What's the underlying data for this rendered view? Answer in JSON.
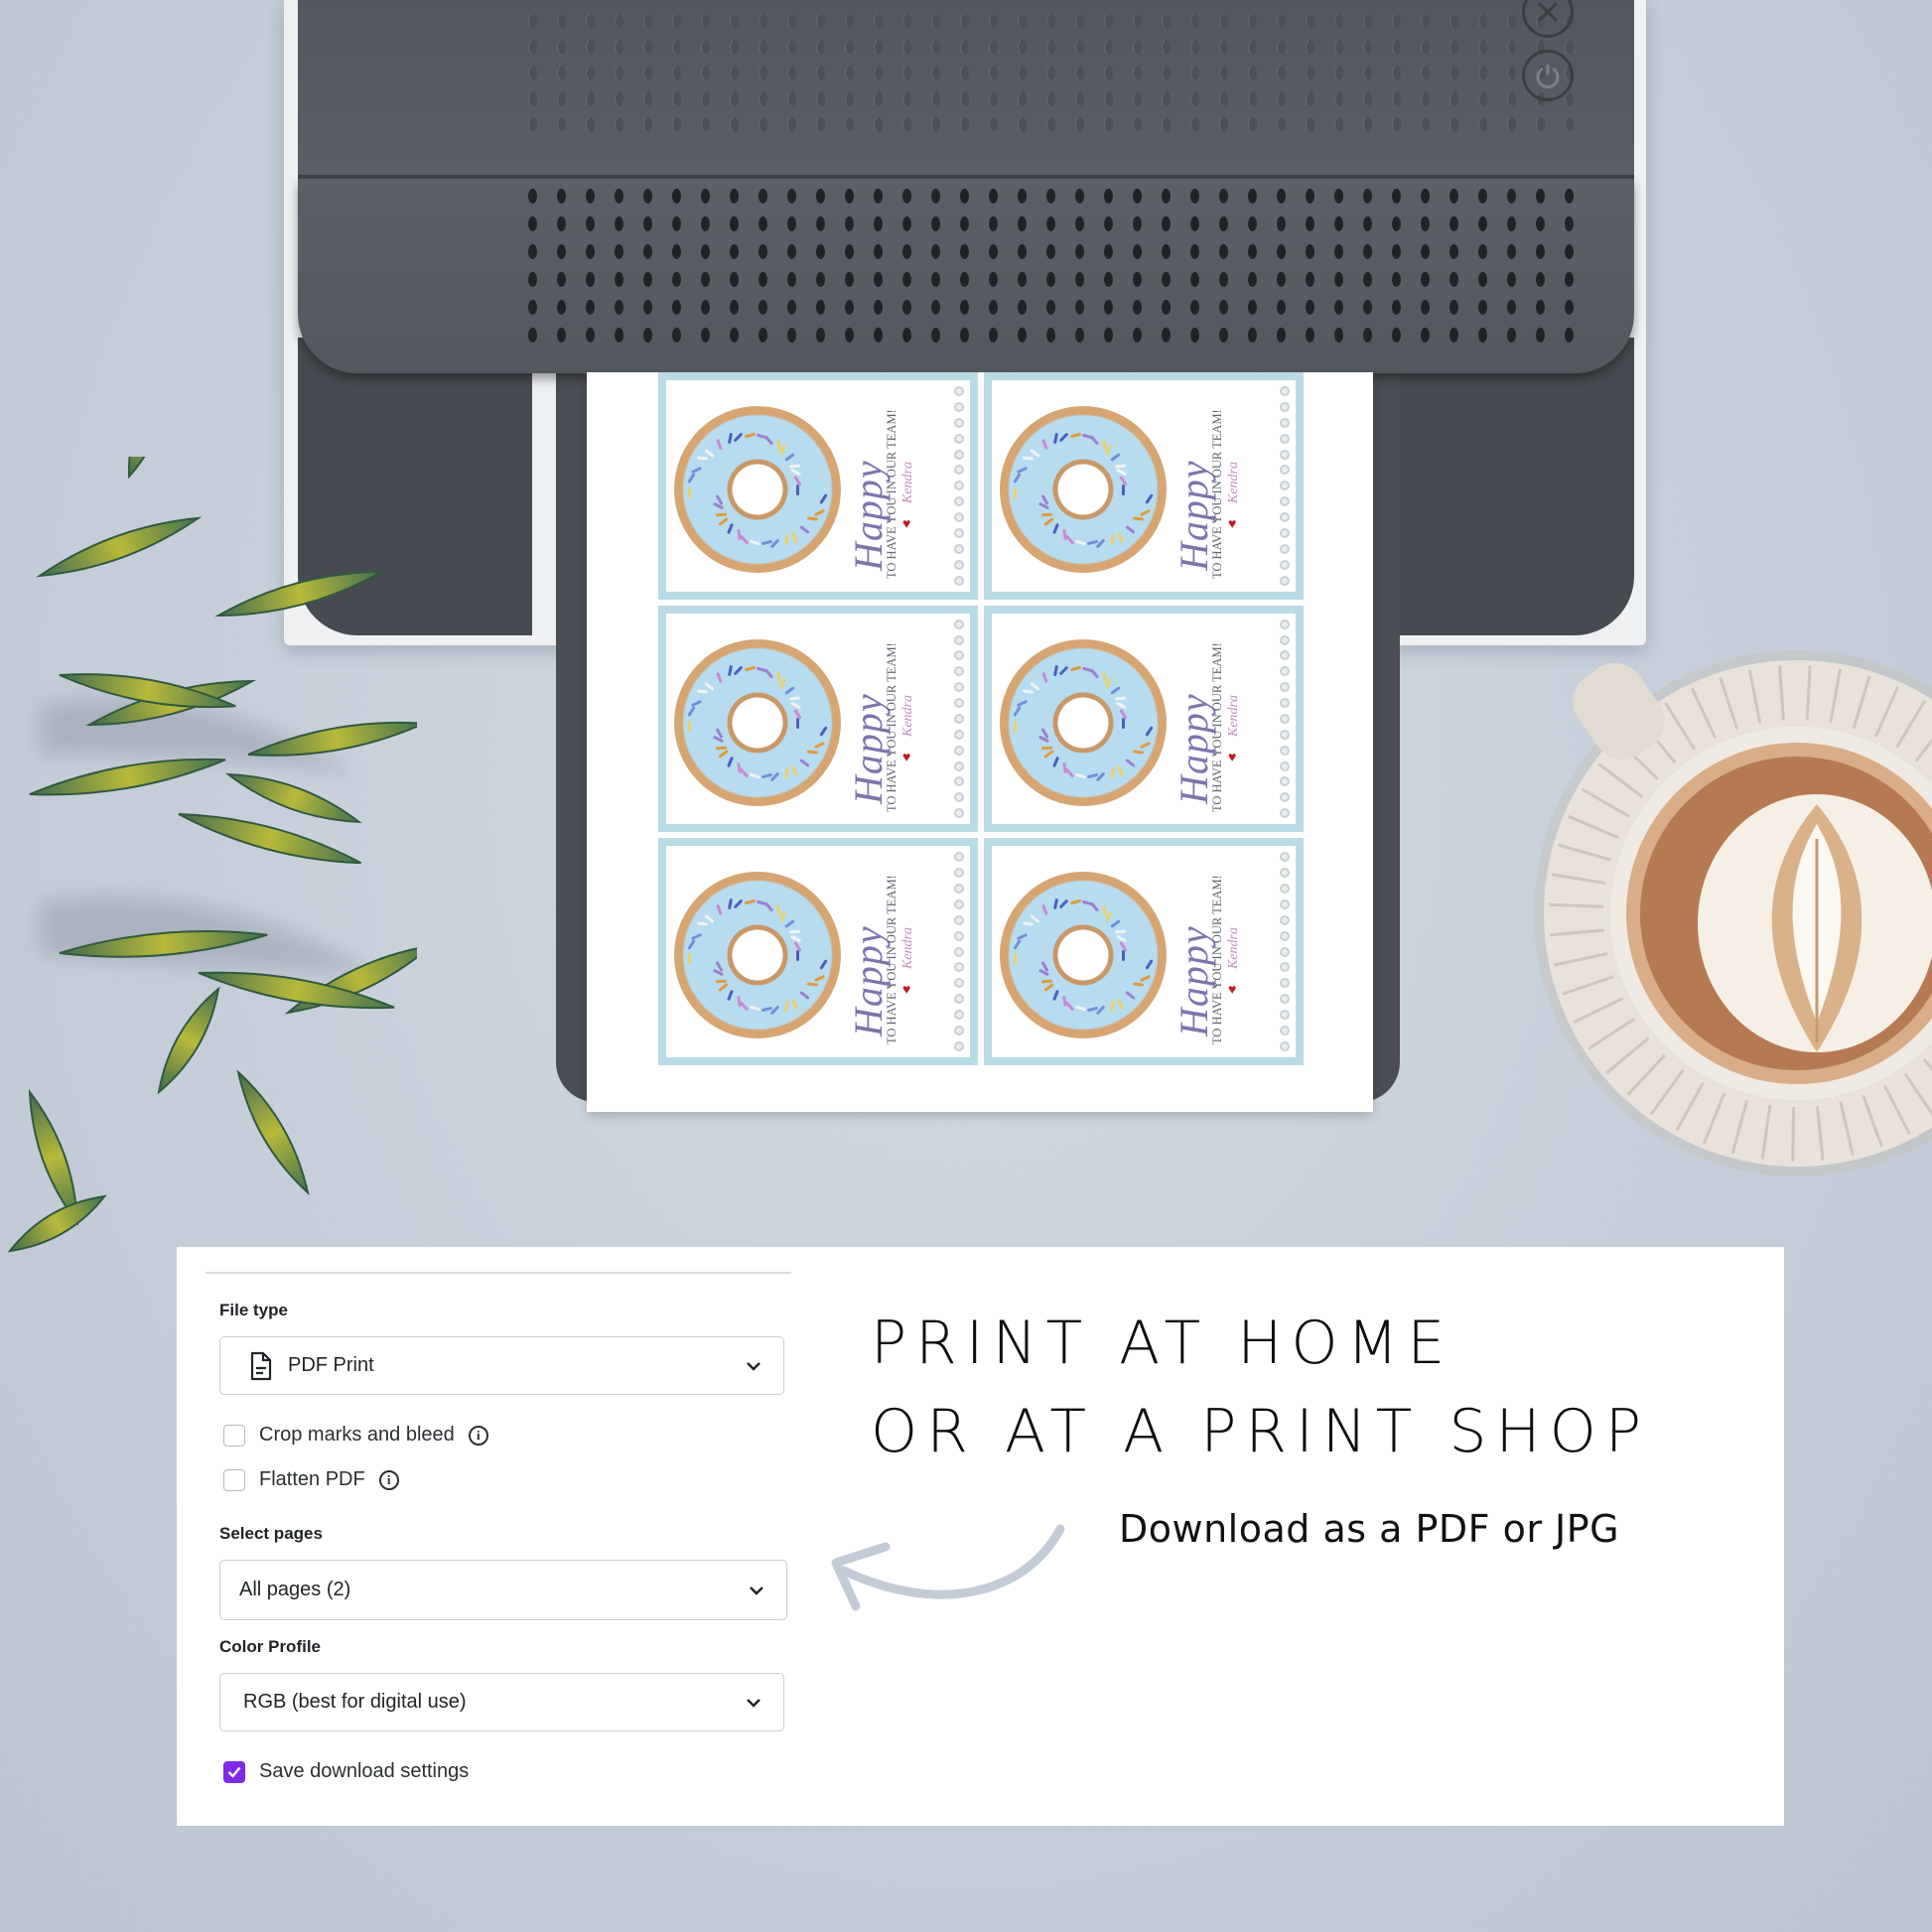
{
  "printer": {
    "buttons": [
      {
        "name": "cancel",
        "icon": "close-circle-icon"
      },
      {
        "name": "power",
        "icon": "power-icon"
      }
    ]
  },
  "printout": {
    "cards": [
      {
        "title": "Happy",
        "subtitle": "TO HAVE YOU IN OUR TEAM!",
        "signature": "Kendra"
      },
      {
        "title": "Happy",
        "subtitle": "TO HAVE YOU IN OUR TEAM!",
        "signature": "Kendra"
      },
      {
        "title": "Happy",
        "subtitle": "TO HAVE YOU IN OUR TEAM!",
        "signature": "Kendra"
      },
      {
        "title": "Happy",
        "subtitle": "TO HAVE YOU IN OUR TEAM!",
        "signature": "Kendra"
      },
      {
        "title": "Happy",
        "subtitle": "TO HAVE YOU IN OUR TEAM!",
        "signature": "Kendra"
      },
      {
        "title": "Happy",
        "subtitle": "TO HAVE YOU IN OUR TEAM!",
        "signature": "Kendra"
      }
    ],
    "colors": {
      "card_border": "#b9dbe6",
      "title": "#7c74ad",
      "signature": "#c48ac0",
      "heart": "#c3161f"
    }
  },
  "download_panel": {
    "file_type": {
      "label": "File type",
      "value": "PDF Print",
      "icon": "document-icon"
    },
    "options": [
      {
        "label": "Crop marks and bleed",
        "checked": false,
        "info": "i"
      },
      {
        "label": "Flatten PDF",
        "checked": false,
        "info": "i"
      }
    ],
    "select_pages": {
      "label": "Select pages",
      "value": "All pages (2)"
    },
    "color_profile": {
      "label": "Color Profile",
      "value": "RGB (best for digital use)"
    },
    "save_settings": {
      "label": "Save download settings",
      "checked": true
    },
    "accent_color": "#7d2ae8"
  },
  "promo": {
    "headline_line1": "PRINT AT HOME",
    "headline_line2": "OR AT A PRINT SHOP",
    "subline": "Download as a PDF or JPG"
  }
}
